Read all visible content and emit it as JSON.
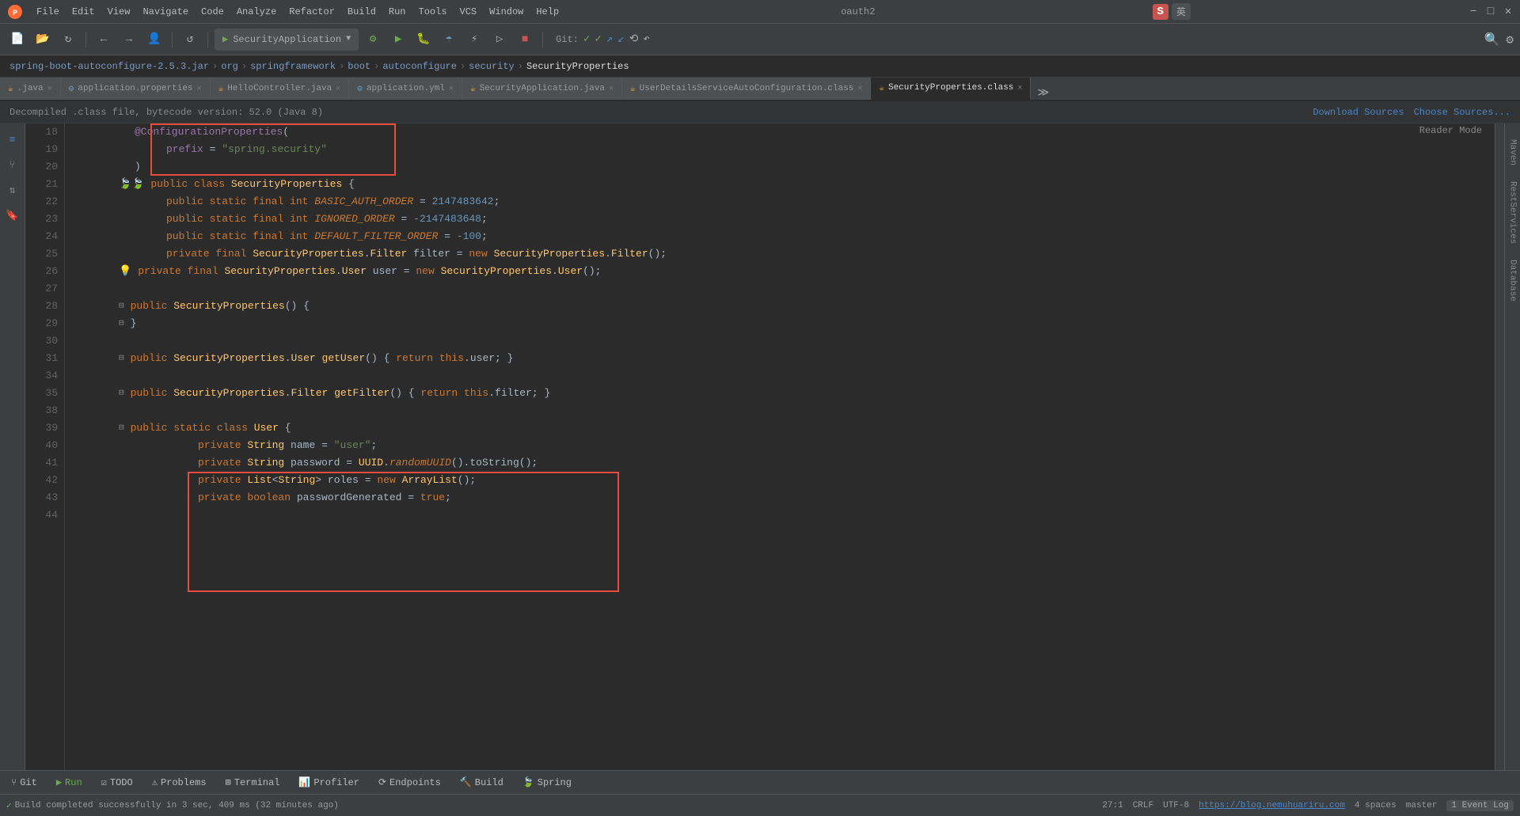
{
  "window": {
    "title": "oauth2"
  },
  "menu": {
    "items": [
      "File",
      "Edit",
      "View",
      "Navigate",
      "Code",
      "Analyze",
      "Refactor",
      "Build",
      "Run",
      "Tools",
      "VCS",
      "Window",
      "Help"
    ]
  },
  "toolbar": {
    "run_config": "SecurityApplication",
    "git_label": "Git:",
    "reader_mode": "Reader Mode"
  },
  "breadcrumb": {
    "parts": [
      "spring-boot-autoconfigure-2.5.3.jar",
      "org",
      "springframework",
      "boot",
      "autoconfigure",
      "security",
      "SecurityProperties"
    ]
  },
  "tabs": [
    {
      "label": ".java",
      "icon": "☕",
      "active": false
    },
    {
      "label": "application.properties",
      "icon": "📄",
      "active": false
    },
    {
      "label": "HelloController.java",
      "icon": "☕",
      "active": false
    },
    {
      "label": "application.yml",
      "icon": "📄",
      "active": false
    },
    {
      "label": "SecurityApplication.java",
      "icon": "☕",
      "active": false
    },
    {
      "label": "UserDetailsServiceAutoConfiguration.class",
      "icon": "☕",
      "active": false
    },
    {
      "label": "SecurityProperties.class",
      "icon": "☕",
      "active": true
    }
  ],
  "info_bar": {
    "text": "Decompiled .class file, bytecode version: 52.0 (Java 8)",
    "download_sources": "Download Sources",
    "choose_sources": "Choose Sources..."
  },
  "code": {
    "lines": [
      {
        "num": 18,
        "content": "@ConfigurationProperties(",
        "indent": 1
      },
      {
        "num": 19,
        "content": "    prefix = \"spring.security\"",
        "indent": 2
      },
      {
        "num": 20,
        "content": ")",
        "indent": 1
      },
      {
        "num": 21,
        "content": "public class SecurityProperties {",
        "indent": 1
      },
      {
        "num": 22,
        "content": "    public static final int BASIC_AUTH_ORDER = 2147483642;",
        "indent": 2
      },
      {
        "num": 23,
        "content": "    public static final int IGNORED_ORDER = -2147483648;",
        "indent": 2
      },
      {
        "num": 24,
        "content": "    public static final int DEFAULT_FILTER_ORDER = -100;",
        "indent": 2
      },
      {
        "num": 25,
        "content": "    private final SecurityProperties.Filter filter = new SecurityProperties.Filter();",
        "indent": 2
      },
      {
        "num": 26,
        "content": "    private final SecurityProperties.User user = new SecurityProperties.User();",
        "indent": 2
      },
      {
        "num": 27,
        "content": "",
        "indent": 0
      },
      {
        "num": 28,
        "content": "    public SecurityProperties() {",
        "indent": 2
      },
      {
        "num": 29,
        "content": "    }",
        "indent": 2
      },
      {
        "num": 30,
        "content": "",
        "indent": 0
      },
      {
        "num": 31,
        "content": "    public SecurityProperties.User getUser() { return this.user; }",
        "indent": 2
      },
      {
        "num": 34,
        "content": "",
        "indent": 0
      },
      {
        "num": 35,
        "content": "    public SecurityProperties.Filter getFilter() { return this.filter; }",
        "indent": 2
      },
      {
        "num": 38,
        "content": "",
        "indent": 0
      },
      {
        "num": 39,
        "content": "    public static class User {",
        "indent": 2
      },
      {
        "num": 40,
        "content": "        private String name = \"user\";",
        "indent": 3
      },
      {
        "num": 41,
        "content": "        private String password = UUID.randomUUID().toString();",
        "indent": 3
      },
      {
        "num": 42,
        "content": "        private List<String> roles = new ArrayList();",
        "indent": 3
      },
      {
        "num": 43,
        "content": "        private boolean passwordGenerated = true;",
        "indent": 3
      },
      {
        "num": 44,
        "content": "",
        "indent": 0
      }
    ]
  },
  "status_bar": {
    "git": "Git",
    "run": "Run",
    "todo": "TODO",
    "problems": "Problems",
    "terminal": "Terminal",
    "profiler": "Profiler",
    "endpoints": "Endpoints",
    "build": "Build",
    "spring": "Spring",
    "position": "27:1",
    "line_ending": "CRLF",
    "encoding": "UTF-8",
    "indent": "4 spaces",
    "build_status": "Build completed successfully in 3 sec, 409 ms (32 minutes ago)",
    "event_log": "1 Event Log",
    "url": "https://blog.nemuhuariru.com"
  },
  "left_sidebar": {
    "icons": [
      "project",
      "commit",
      "pull-requests",
      "bookmarks",
      "structure"
    ]
  },
  "right_sidebar": {
    "labels": [
      "Maven",
      "RestServices",
      "Database"
    ]
  }
}
